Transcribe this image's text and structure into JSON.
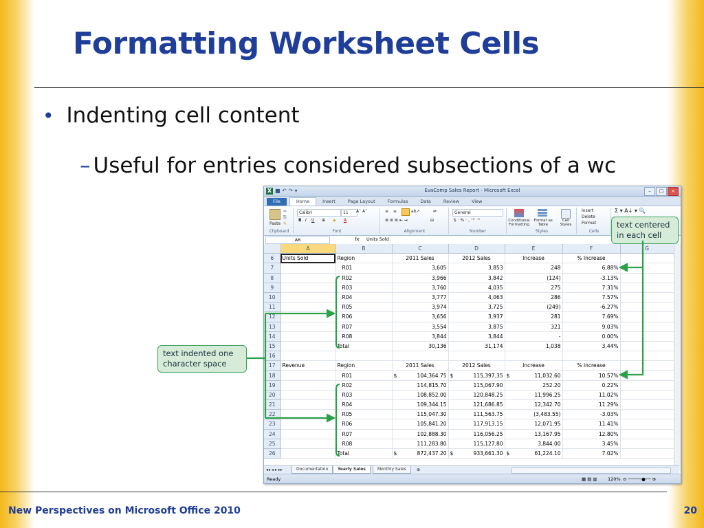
{
  "slide": {
    "title": "Formatting Worksheet Cells",
    "bullet_1": "Indenting cell content",
    "bullet_2_dash": "–",
    "bullet_2": "Useful for entries considered subsections of a wc",
    "footer_left": "New Perspectives on Microsoft Office 2010",
    "page_number": "20"
  },
  "callouts": {
    "centered": "text centered in each cell",
    "indented": "text indented one character space"
  },
  "excel": {
    "window_title": "EvaComp Sales Report - Microsoft Excel",
    "tabs": [
      "File",
      "Home",
      "Insert",
      "Page Layout",
      "Formulas",
      "Data",
      "Review",
      "View"
    ],
    "active_tab": "Home",
    "ribbon": {
      "font_name": "Calibri",
      "font_size": "11",
      "number_format": "General",
      "paste": "Paste",
      "conditional": "Conditional Formatting",
      "format_table": "Format as Table",
      "cell_styles": "Cell Styles",
      "insert": "Insert",
      "delete": "Delete",
      "format": "Format",
      "groups": [
        "Clipboard",
        "Font",
        "Alignment",
        "Number",
        "Styles",
        "Cells"
      ]
    },
    "name_box": "A6",
    "fx": "fx",
    "formula": "Units Sold",
    "columns": [
      "A",
      "B",
      "C",
      "D",
      "E",
      "F",
      "G"
    ],
    "rows": [
      {
        "n": "6",
        "a": "Units Sold",
        "b": "Region",
        "c": "2011 Sales",
        "d": "2012 Sales",
        "e": "Increase",
        "f": "% Increase",
        "hdr": true
      },
      {
        "n": "7",
        "a": "",
        "b": "R01",
        "c": "3,605",
        "d": "3,853",
        "e": "248",
        "f": "6.88%"
      },
      {
        "n": "8",
        "a": "",
        "b": "R02",
        "c": "3,966",
        "d": "3,842",
        "e": "(124)",
        "f": "-3.13%"
      },
      {
        "n": "9",
        "a": "",
        "b": "R03",
        "c": "3,760",
        "d": "4,035",
        "e": "275",
        "f": "7.31%"
      },
      {
        "n": "10",
        "a": "",
        "b": "R04",
        "c": "3,777",
        "d": "4,063",
        "e": "286",
        "f": "7.57%"
      },
      {
        "n": "11",
        "a": "",
        "b": "R05",
        "c": "3,974",
        "d": "3,725",
        "e": "(249)",
        "f": "-6.27%"
      },
      {
        "n": "12",
        "a": "",
        "b": "R06",
        "c": "3,656",
        "d": "3,937",
        "e": "281",
        "f": "7.69%"
      },
      {
        "n": "13",
        "a": "",
        "b": "R07",
        "c": "3,554",
        "d": "3,875",
        "e": "321",
        "f": "9.03%"
      },
      {
        "n": "14",
        "a": "",
        "b": "R08",
        "c": "3,844",
        "d": "3,844",
        "e": "-",
        "f": "0.00%"
      },
      {
        "n": "15",
        "a": "",
        "b": "Total",
        "c": "30,136",
        "d": "31,174",
        "e": "1,038",
        "f": "3.44%",
        "total": true
      },
      {
        "n": "16",
        "a": "",
        "b": "",
        "c": "",
        "d": "",
        "e": "",
        "f": ""
      },
      {
        "n": "17",
        "a": "Revenue",
        "b": "Region",
        "c": "2011 Sales",
        "d": "2012 Sales",
        "e": "Increase",
        "f": "% Increase",
        "hdr": true
      },
      {
        "n": "18",
        "a": "",
        "b": "R01",
        "c": "104,364.75",
        "d": "115,397.35",
        "e": "11,032.60",
        "f": "10.57%",
        "cur": true
      },
      {
        "n": "19",
        "a": "",
        "b": "R02",
        "c": "114,815.70",
        "d": "115,067.90",
        "e": "252.20",
        "f": "0.22%"
      },
      {
        "n": "20",
        "a": "",
        "b": "R03",
        "c": "108,852.00",
        "d": "120,848.25",
        "e": "11,996.25",
        "f": "11.02%"
      },
      {
        "n": "21",
        "a": "",
        "b": "R04",
        "c": "109,344.15",
        "d": "121,686.85",
        "e": "12,342.70",
        "f": "11.29%"
      },
      {
        "n": "22",
        "a": "",
        "b": "R05",
        "c": "115,047.30",
        "d": "111,563.75",
        "e": "(3,483.55)",
        "f": "-3.03%"
      },
      {
        "n": "23",
        "a": "",
        "b": "R06",
        "c": "105,841.20",
        "d": "117,913.15",
        "e": "12,071.95",
        "f": "11.41%"
      },
      {
        "n": "24",
        "a": "",
        "b": "R07",
        "c": "102,888.30",
        "d": "116,056.25",
        "e": "13,167.95",
        "f": "12.80%"
      },
      {
        "n": "25",
        "a": "",
        "b": "R08",
        "c": "111,283.80",
        "d": "115,127.80",
        "e": "3,844.00",
        "f": "3.45%"
      },
      {
        "n": "26",
        "a": "",
        "b": "Total",
        "c": "872,437.20",
        "d": "933,661.30",
        "e": "61,224.10",
        "f": "7.02%",
        "cur": true,
        "total": true
      }
    ],
    "currency_symbol": "$",
    "sheet_tabs": [
      "Documentation",
      "Yearly Sales",
      "Monthly Sales"
    ],
    "active_sheet": "Yearly Sales",
    "status": "Ready",
    "zoom": "120%"
  },
  "colors": {
    "title_blue": "#1f3e99",
    "accent_gold": "#f3b91b",
    "callout_green": "#3aa55a",
    "callout_fill": "#d7ebd9"
  }
}
